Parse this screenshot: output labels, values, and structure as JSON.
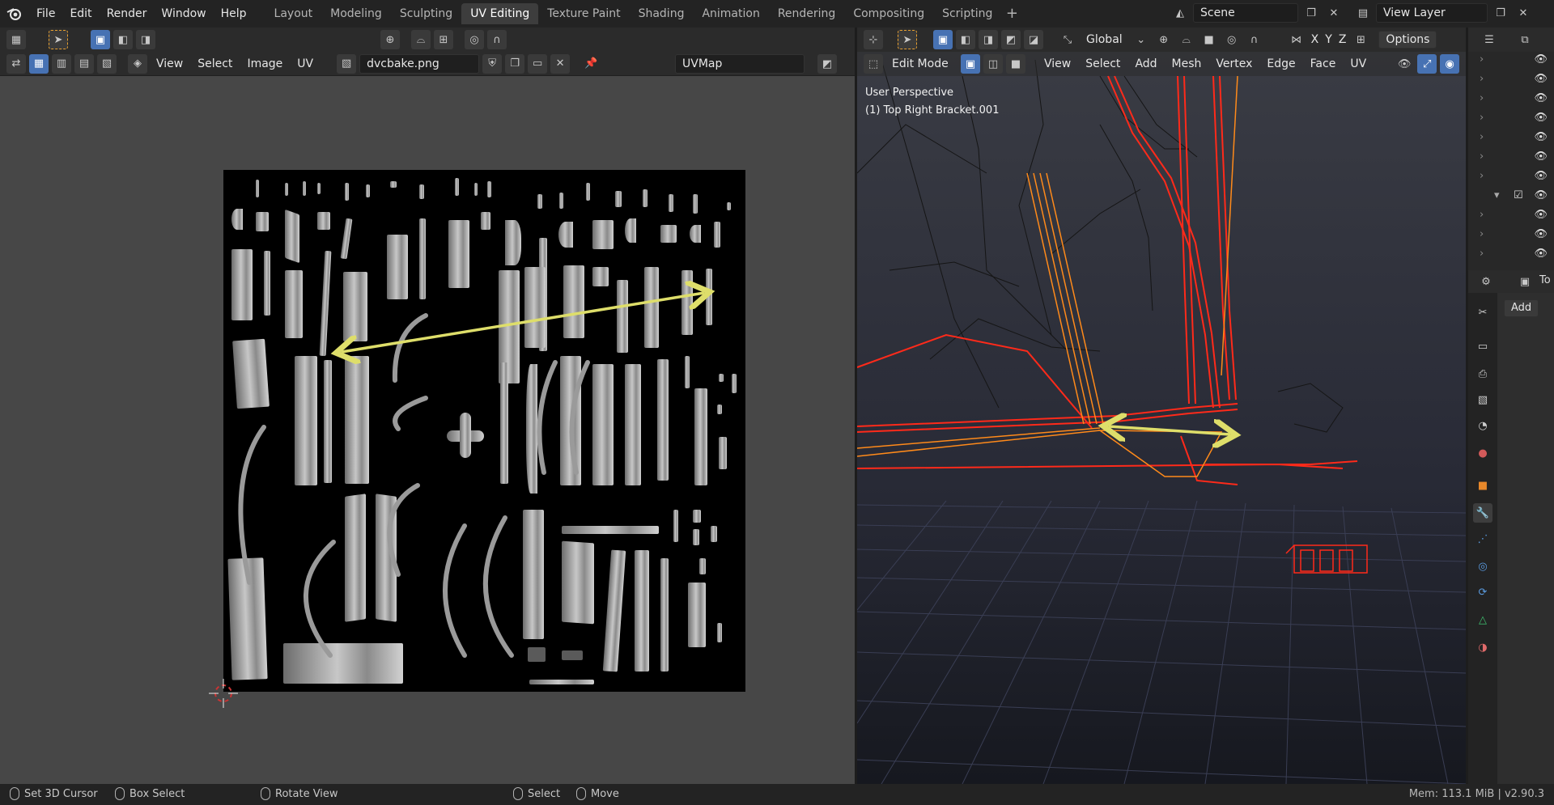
{
  "topbar": {
    "menus": [
      "File",
      "Edit",
      "Render",
      "Window",
      "Help"
    ],
    "workspaces": [
      "Layout",
      "Modeling",
      "Sculpting",
      "UV Editing",
      "Texture Paint",
      "Shading",
      "Animation",
      "Rendering",
      "Compositing",
      "Scripting"
    ],
    "active_workspace": "UV Editing",
    "add_workspace": "+",
    "scene": "Scene",
    "view_layer": "View Layer"
  },
  "uv_editor": {
    "menus": [
      "View",
      "Select",
      "Image",
      "UV"
    ],
    "image_name": "dvcbake.png",
    "uv_map": "UVMap",
    "arrow_color": "#dede6a",
    "background_color": "#474747"
  },
  "viewport": {
    "mode": "Edit Mode",
    "transform_orientation": "Global",
    "menus": [
      "View",
      "Select",
      "Add",
      "Mesh",
      "Vertex",
      "Edge",
      "Face",
      "UV"
    ],
    "axes": [
      "X",
      "Y",
      "Z"
    ],
    "options_label": "Options",
    "perspective_label": "User Perspective",
    "object_label": "(1) Top Right Bracket.001",
    "wire_color": "#ff2a1a",
    "selected_color": "#ff8a1a",
    "arrow_color": "#dede6a"
  },
  "properties": {
    "add_label": "Add",
    "tool_label": "To"
  },
  "statusbar": {
    "items": [
      "Set 3D Cursor",
      "Box Select",
      "Rotate View",
      "Select",
      "Move"
    ],
    "memory": "Mem: 113.1 MiB | v2.90.3"
  }
}
